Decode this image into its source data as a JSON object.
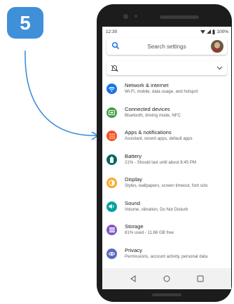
{
  "step": {
    "number": "5"
  },
  "status_bar": {
    "time": "12:30",
    "battery": "100%"
  },
  "search": {
    "placeholder": "Search settings"
  },
  "settings": [
    {
      "title": "Network & internet",
      "subtitle": "Wi-Fi, mobile, data usage, and hotspot",
      "icon": "wifi-icon",
      "color": "#1a73e8"
    },
    {
      "title": "Connected devices",
      "subtitle": "Bluetooth, driving mode, NFC",
      "icon": "devices-icon",
      "color": "#43a047"
    },
    {
      "title": "Apps & notifications",
      "subtitle": "Assistant, recent apps, default apps",
      "icon": "apps-icon",
      "color": "#f4511e"
    },
    {
      "title": "Battery",
      "subtitle": "21% - Should last until about 8:45 PM",
      "icon": "battery-icon",
      "color": "#00695c"
    },
    {
      "title": "Display",
      "subtitle": "Styles, wallpapers, screen timeout, font size",
      "icon": "display-icon",
      "color": "#f9a825"
    },
    {
      "title": "Sound",
      "subtitle": "Volume, vibration, Do Not Disturb",
      "icon": "sound-icon",
      "color": "#00a19b"
    },
    {
      "title": "Storage",
      "subtitle": "81% used - 11.86 GB free",
      "icon": "storage-icon",
      "color": "#7e57c2"
    },
    {
      "title": "Privacy",
      "subtitle": "Permissions, account activity, personal data",
      "icon": "privacy-icon",
      "color": "#5c6bc0"
    }
  ],
  "colors": {
    "step_badge": "#3f8fd9",
    "arrow": "#3f8fd9",
    "search_icon": "#1a73e8"
  }
}
